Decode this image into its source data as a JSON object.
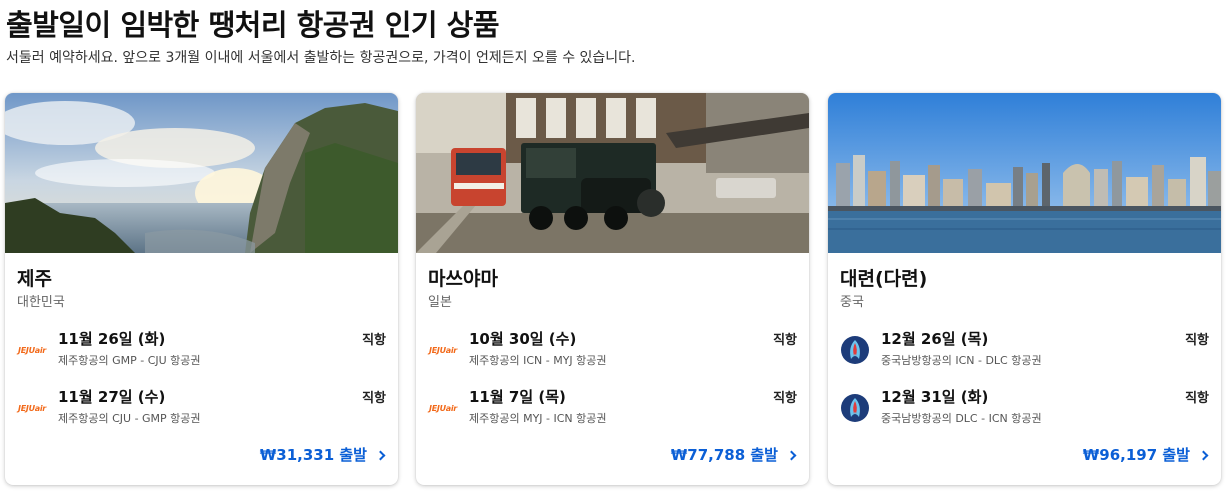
{
  "header": {
    "title": "출발일이 임박한 땡처리 항공권 인기 상품",
    "subtitle": "서둘러 예약하세요. 앞으로 3개월 이내에 서울에서 출발하는 항공권으로, 가격이 언제든지 오를 수 있습니다."
  },
  "colors": {
    "accent": "#0b5fd6",
    "jeju_air": "#f26a1b",
    "china_southern": "#1d3c7a"
  },
  "cards": [
    {
      "city": "제주",
      "country": "대한민국",
      "flights": [
        {
          "airline_logo": "JEJUair",
          "date": "11월 26일 (화)",
          "route": "제주항공의 GMP - CJU 항공권",
          "type": "직항"
        },
        {
          "airline_logo": "JEJUair",
          "date": "11월 27일 (수)",
          "route": "제주항공의 CJU - GMP 항공권",
          "type": "직항"
        }
      ],
      "price": "₩31,331 출발"
    },
    {
      "city": "마쓰야마",
      "country": "일본",
      "flights": [
        {
          "airline_logo": "JEJUair",
          "date": "10월 30일 (수)",
          "route": "제주항공의 ICN - MYJ 항공권",
          "type": "직항"
        },
        {
          "airline_logo": "JEJUair",
          "date": "11월 7일 (목)",
          "route": "제주항공의 MYJ - ICN 항공권",
          "type": "직항"
        }
      ],
      "price": "₩77,788 출발"
    },
    {
      "city": "대련(다련)",
      "country": "중국",
      "flights": [
        {
          "airline_logo": "china-southern-icon",
          "date": "12월 26일 (목)",
          "route": "중국남방항공의 ICN - DLC 항공권",
          "type": "직항"
        },
        {
          "airline_logo": "china-southern-icon",
          "date": "12월 31일 (화)",
          "route": "중국남방항공의 DLC - ICN 항공권",
          "type": "직항"
        }
      ],
      "price": "₩96,197 출발"
    }
  ]
}
